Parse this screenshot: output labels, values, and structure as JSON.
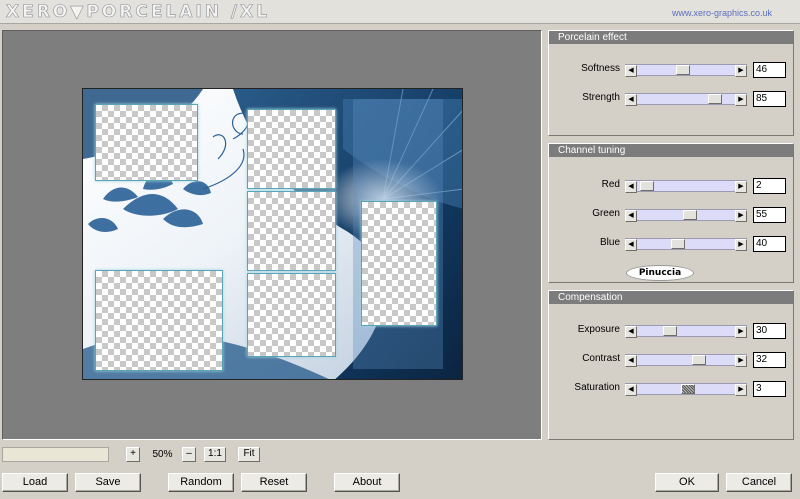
{
  "app": {
    "title": "XERO▼PORCELAIN /XL",
    "site_url": "www.xero-graphics.co.uk",
    "watermark": "Pinuccia"
  },
  "zoom": {
    "plus_label": "+",
    "value": "50%",
    "minus_label": "–",
    "one_to_one_label": "1:1",
    "fit_label": "Fit"
  },
  "buttons": {
    "load": "Load",
    "save": "Save",
    "random": "Random",
    "reset": "Reset",
    "about": "About",
    "ok": "OK",
    "cancel": "Cancel"
  },
  "panels": {
    "porcelain": {
      "title": "Porcelain effect",
      "controls": [
        {
          "label": "Softness",
          "value": "46",
          "level": 0.46
        },
        {
          "label": "Strength",
          "value": "85",
          "level": 0.85
        }
      ]
    },
    "channel": {
      "title": "Channel tuning",
      "controls": [
        {
          "label": "Red",
          "value": "2",
          "level": 0.02
        },
        {
          "label": "Green",
          "value": "55",
          "level": 0.55
        },
        {
          "label": "Blue",
          "value": "40",
          "level": 0.4
        }
      ]
    },
    "compensation": {
      "title": "Compensation",
      "controls": [
        {
          "label": "Exposure",
          "value": "30",
          "level": 0.3
        },
        {
          "label": "Contrast",
          "value": "32",
          "level": 0.66
        },
        {
          "label": "Saturation",
          "value": "3",
          "level": 0.53
        }
      ]
    }
  },
  "colors": {
    "accent_blue": "#1f4d78",
    "panel_header": "#7c7c7c",
    "slider_track": "#dcdcf8",
    "url_color": "#5c6fc0"
  }
}
